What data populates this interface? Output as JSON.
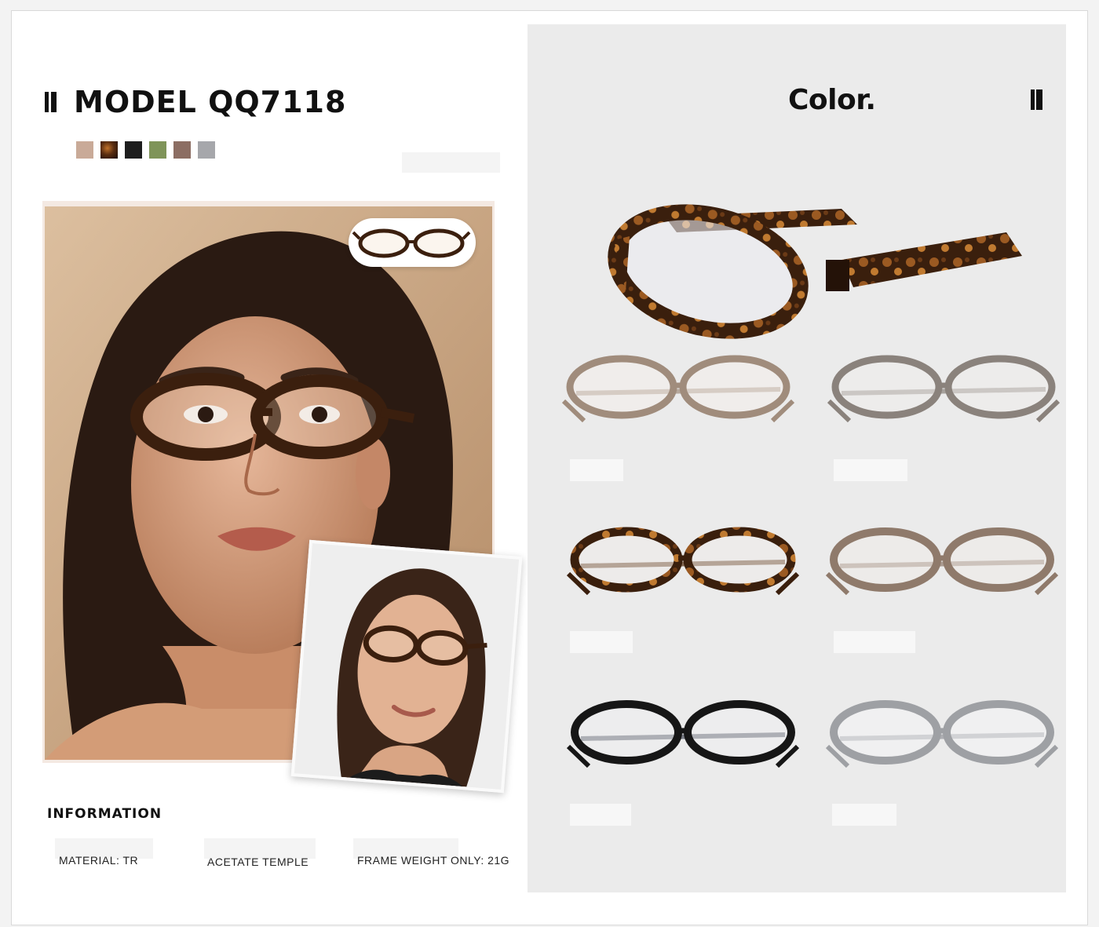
{
  "header": {
    "model_title": "MODEL QQ7118"
  },
  "swatches": [
    {
      "name": "beige",
      "color": "#c9aa98"
    },
    {
      "name": "tortoise",
      "color": "#4a2a14"
    },
    {
      "name": "black",
      "color": "#1e1e1e"
    },
    {
      "name": "olive",
      "color": "#7f9459"
    },
    {
      "name": "brown",
      "color": "#8c6e63"
    },
    {
      "name": "grey",
      "color": "#a6a7ab"
    }
  ],
  "color_panel": {
    "title": "Color."
  },
  "information": {
    "title": "INFORMATION",
    "specs": [
      "MATERIAL: TR",
      "ACETATE TEMPLE",
      "FRAME WEIGHT ONLY: 21G"
    ]
  },
  "icons": {
    "bars_left": "double-bar-icon",
    "bars_right": "double-bar-icon"
  },
  "frame_colors": {
    "tortoise": "#3f2412",
    "tortoise_light": "#8a5a2a",
    "clear_brown": "#a08c7c",
    "grey_brown": "#8a827c",
    "tan_brown": "#8f7a6b",
    "black": "#161616",
    "clear_grey": "#9ea0a4"
  }
}
